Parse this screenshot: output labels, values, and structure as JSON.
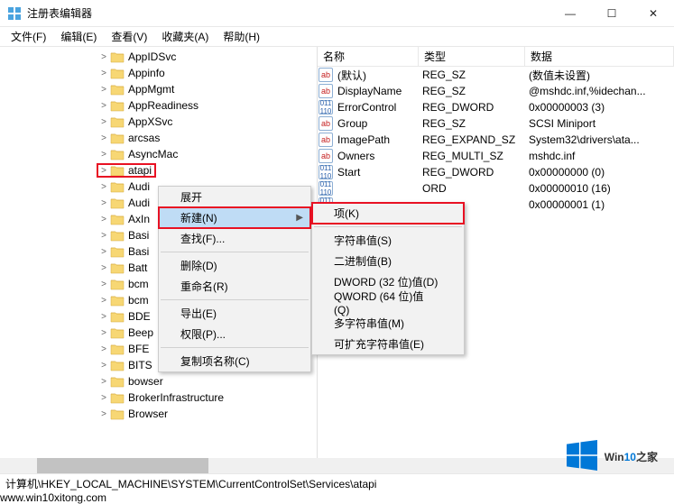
{
  "window": {
    "title": "注册表编辑器",
    "min": "—",
    "max": "☐",
    "close": "✕"
  },
  "menubar": [
    "文件(F)",
    "编辑(E)",
    "查看(V)",
    "收藏夹(A)",
    "帮助(H)"
  ],
  "tree_indent": [
    {
      "label": "AppIDSvc",
      "indent": 108
    },
    {
      "label": "Appinfo",
      "indent": 108
    },
    {
      "label": "AppMgmt",
      "indent": 108
    },
    {
      "label": "AppReadiness",
      "indent": 108
    },
    {
      "label": "AppXSvc",
      "indent": 108
    },
    {
      "label": "arcsas",
      "indent": 108
    },
    {
      "label": "AsyncMac",
      "indent": 108
    },
    {
      "label": "atapi",
      "indent": 108,
      "selected": true
    },
    {
      "label": "Audi",
      "indent": 108
    },
    {
      "label": "Audi",
      "indent": 108
    },
    {
      "label": "AxIn",
      "indent": 108
    },
    {
      "label": "Basi",
      "indent": 108
    },
    {
      "label": "Basi",
      "indent": 108
    },
    {
      "label": "Batt",
      "indent": 108
    },
    {
      "label": "bcm",
      "indent": 108
    },
    {
      "label": "bcm",
      "indent": 108
    },
    {
      "label": "BDE",
      "indent": 108
    },
    {
      "label": "Beep",
      "indent": 108
    },
    {
      "label": "BFE",
      "indent": 108
    },
    {
      "label": "BITS",
      "indent": 108
    },
    {
      "label": "bowser",
      "indent": 108
    },
    {
      "label": "BrokerInfrastructure",
      "indent": 108
    },
    {
      "label": "Browser",
      "indent": 108
    }
  ],
  "value_columns": {
    "name": "名称",
    "type": "类型",
    "data": "数据"
  },
  "values": [
    {
      "icon": "ab",
      "name": "(默认)",
      "type": "REG_SZ",
      "data": "(数值未设置)"
    },
    {
      "icon": "ab",
      "name": "DisplayName",
      "type": "REG_SZ",
      "data": "@mshdc.inf,%idechan..."
    },
    {
      "icon": "num",
      "name": "ErrorControl",
      "type": "REG_DWORD",
      "data": "0x00000003 (3)"
    },
    {
      "icon": "ab",
      "name": "Group",
      "type": "REG_SZ",
      "data": "SCSI Miniport"
    },
    {
      "icon": "ab",
      "name": "ImagePath",
      "type": "REG_EXPAND_SZ",
      "data": "System32\\drivers\\ata..."
    },
    {
      "icon": "ab",
      "name": "Owners",
      "type": "REG_MULTI_SZ",
      "data": "mshdc.inf"
    },
    {
      "icon": "num",
      "name": "Start",
      "type": "REG_DWORD",
      "data": "0x00000000 (0)"
    },
    {
      "icon": "num",
      "name": "",
      "type": "ORD",
      "data": "0x00000010 (16)"
    },
    {
      "icon": "num",
      "name": "",
      "type": "",
      "data": "0x00000001 (1)"
    }
  ],
  "context1": {
    "expand": "展开",
    "new": "新建(N)",
    "find": "查找(F)...",
    "delete": "删除(D)",
    "rename": "重命名(R)",
    "export": "导出(E)",
    "perm": "权限(P)...",
    "copy": "复制项名称(C)"
  },
  "context2": {
    "key": "项(K)",
    "string": "字符串值(S)",
    "binary": "二进制值(B)",
    "dword": "DWORD (32 位)值(D)",
    "qword": "QWORD (64 位)值(Q)",
    "multi": "多字符串值(M)",
    "expand": "可扩充字符串值(E)"
  },
  "status": "计算机\\HKEY_LOCAL_MACHINE\\SYSTEM\\CurrentControlSet\\Services\\atapi",
  "watermark": {
    "brand_a": "Win",
    "brand_b": "10",
    "brand_c": "之家",
    "url": "www.win10xitong.com"
  }
}
